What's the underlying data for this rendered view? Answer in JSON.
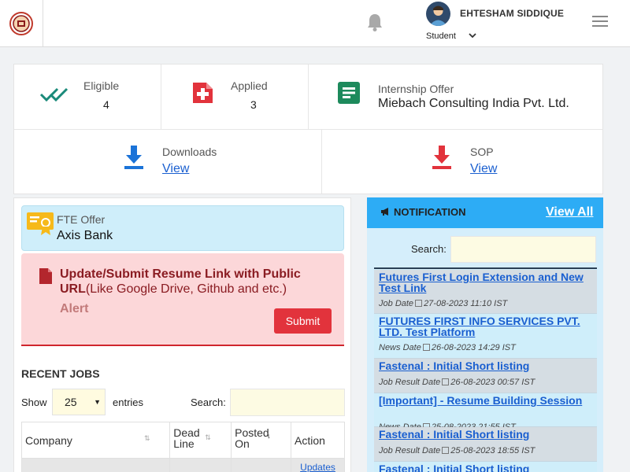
{
  "user": {
    "name": "EHTESHAM SIDDIQUE",
    "role": "Student"
  },
  "stats": {
    "eligible_label": "Eligible",
    "eligible_value": "4",
    "applied_label": "Applied",
    "applied_value": "3",
    "internship_label": "Internship Offer",
    "internship_value": "Miebach Consulting India Pvt. Ltd.",
    "downloads_label": "Downloads",
    "downloads_link": "View",
    "sop_label": "SOP",
    "sop_link": "View"
  },
  "fte": {
    "label": "FTE Offer",
    "company": "Axis Bank"
  },
  "alert": {
    "title_bold": "Update/Submit Resume Link with Public URL",
    "title_rest": "(Like Google Drive, Github and etc.)",
    "tag": "Alert",
    "submit": "Submit"
  },
  "recent_jobs": {
    "title": "RECENT JOBS",
    "show": "Show",
    "entries_value": "25",
    "entries": "entries",
    "search_label": "Search:",
    "columns": [
      "Company",
      "Dead Line",
      "Posted On",
      "Action"
    ],
    "first_row_action": "Updates"
  },
  "notification": {
    "title": "NOTIFICATION",
    "view_all": "View All",
    "search_label": "Search:",
    "date_label": "Date",
    "items": [
      {
        "title": "Futures First Login Extension and New Test Link",
        "type": "Job",
        "date": "27-08-2023 11:10 IST"
      },
      {
        "title": "FUTURES FIRST INFO SERVICES PVT. LTD. Test Platform",
        "type": "News",
        "date": "26-08-2023 14:29 IST"
      },
      {
        "title": "Fastenal : Initial Short listing",
        "type": "Job Result",
        "date": "26-08-2023 00:57 IST"
      },
      {
        "title": "[Important] - Resume Building Session",
        "type": "News",
        "date": "25-08-2023 21:55 IST"
      },
      {
        "title": "Fastenal : Initial Short listing",
        "type": "Job Result",
        "date": "25-08-2023 18:55 IST"
      },
      {
        "title": "Fastenal : Initial Short listing",
        "type": "",
        "date": ""
      }
    ]
  },
  "colors": {
    "accent_blue": "#2dacf5",
    "alert_red": "#d0262d",
    "link": "#1a5fd0",
    "check_green": "#1a8a7a"
  }
}
